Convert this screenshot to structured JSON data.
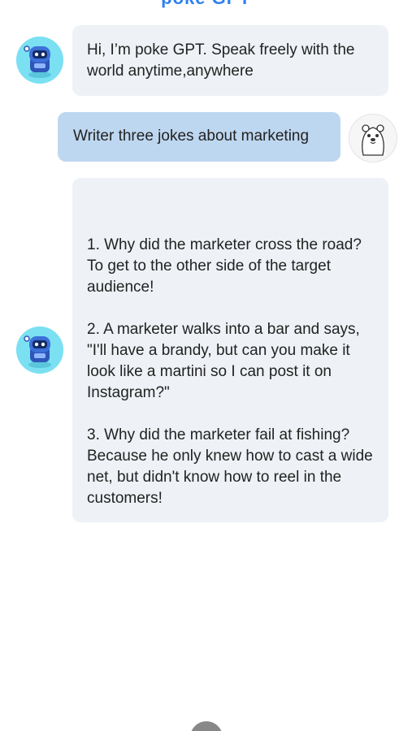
{
  "header": {
    "title": "poke GPT"
  },
  "conversation": {
    "messages": [
      {
        "role": "assistant",
        "avatar": "robot-avatar-icon",
        "text": "Hi, I’m poke GPT. Speak freely with the world anytime,anywhere"
      },
      {
        "role": "user",
        "avatar": "gopher-avatar-icon",
        "text": "Writer three jokes about marketing"
      },
      {
        "role": "assistant",
        "avatar": "robot-avatar-icon",
        "text": "1. Why did the marketer cross the road? To get to the other side of the target audience!\n\n2. A marketer walks into a bar and says, \"I'll have a brandy, but can you make it look like a martini so I can post it on Instagram?\"\n\n3. Why did the marketer fail at fishing? Because he only knew how to cast a wide net, but didn't know how to reel in the customers!"
      }
    ]
  },
  "footer": {
    "icon": "user-icon"
  },
  "colors": {
    "accent": "#2f80ed",
    "bot_bubble": "#eef2f6",
    "user_bubble": "#bed7f0",
    "bot_avatar_bg": "#7be0f2"
  }
}
